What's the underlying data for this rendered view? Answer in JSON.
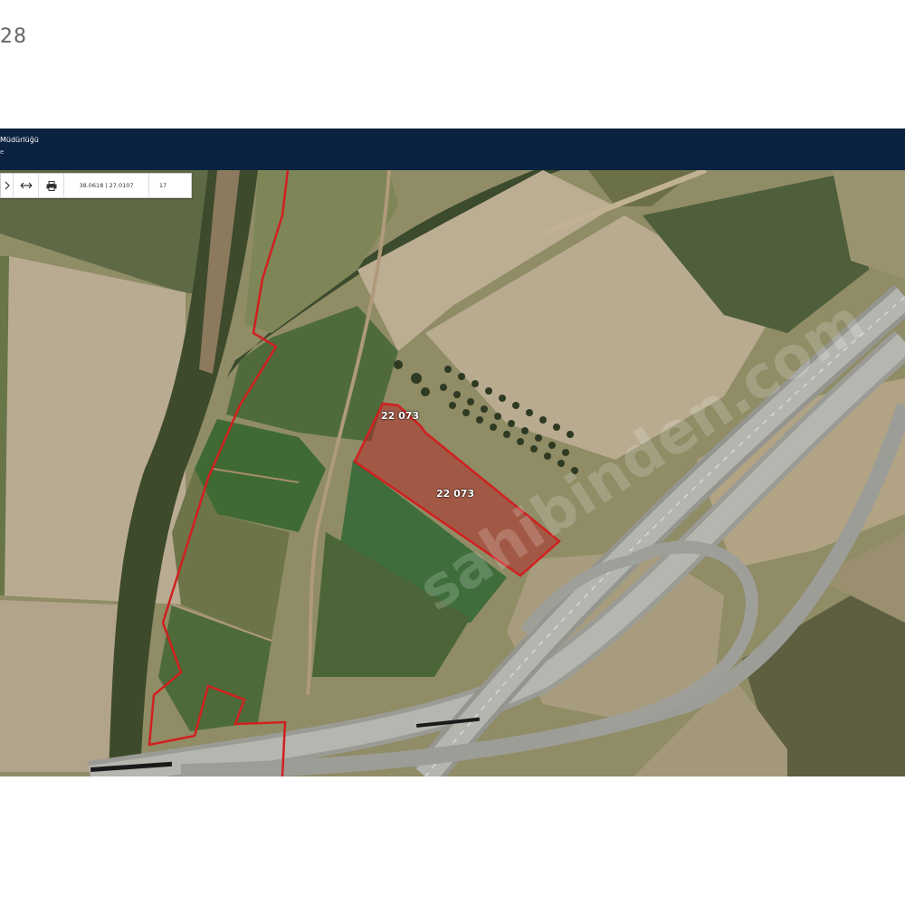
{
  "page": {
    "number": "28"
  },
  "header": {
    "title": "Müdürlüğü",
    "subtitle": "e"
  },
  "toolbar": {
    "coords": "38.0618 | 27.0107",
    "zoom": "17",
    "arrows_icon": "arrows-horizontal-icon",
    "print_icon": "printer-icon"
  },
  "parcels": [
    {
      "id": "parcel-small",
      "label": "22 073"
    },
    {
      "id": "parcel-main",
      "label": "22 073"
    }
  ],
  "watermark": "sahibinden.com",
  "colors": {
    "header": "#0b2240",
    "parcel_border": "#d0201f",
    "parcel_fill": "#b32525"
  }
}
